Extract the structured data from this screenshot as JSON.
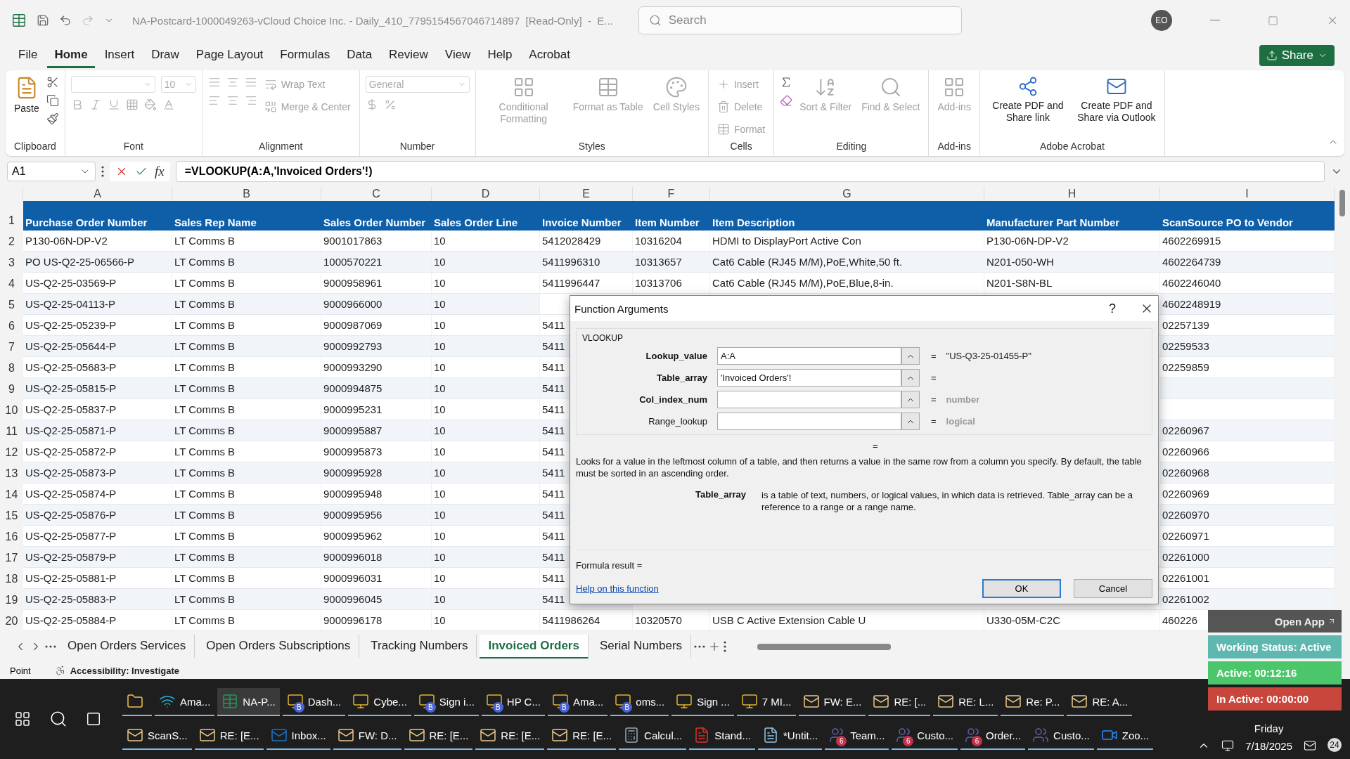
{
  "window": {
    "title": "NA-Postcard-1000049263-vCloud Choice Inc. - Daily_410_7795154567046714897  [Read-Only]  -  E...",
    "search_placeholder": "Search",
    "avatar": "EO"
  },
  "menu": [
    {
      "label": "File",
      "selected": false
    },
    {
      "label": "Home",
      "selected": true
    },
    {
      "label": "Insert",
      "selected": false
    },
    {
      "label": "Draw",
      "selected": false
    },
    {
      "label": "Page Layout",
      "selected": false
    },
    {
      "label": "Formulas",
      "selected": false
    },
    {
      "label": "Data",
      "selected": false
    },
    {
      "label": "Review",
      "selected": false
    },
    {
      "label": "View",
      "selected": false
    },
    {
      "label": "Help",
      "selected": false
    },
    {
      "label": "Acrobat",
      "selected": false
    }
  ],
  "share": "Share",
  "ribbon": [
    {
      "kind": "clipboard",
      "label": "Clipboard",
      "items": [
        {
          "label": "Paste",
          "disabled": false
        }
      ]
    },
    {
      "kind": "font",
      "label": "Font",
      "size": "10"
    },
    {
      "kind": "alignment",
      "label": "Alignment",
      "items": [
        {
          "label": "Wrap Text",
          "disabled": true
        },
        {
          "label": "Merge & Center",
          "disabled": true
        }
      ]
    },
    {
      "kind": "number",
      "label": "Number",
      "format": "General"
    },
    {
      "kind": "styles",
      "label": "Styles",
      "items": [
        {
          "label": "Conditional Formatting",
          "disabled": true
        },
        {
          "label": "Format as Table",
          "disabled": true
        },
        {
          "label": "Cell Styles",
          "disabled": true
        }
      ]
    },
    {
      "kind": "cells",
      "label": "Cells",
      "items": [
        {
          "label": "Insert",
          "disabled": true
        },
        {
          "label": "Delete",
          "disabled": true
        },
        {
          "label": "Format",
          "disabled": true
        }
      ]
    },
    {
      "kind": "editing",
      "label": "Editing",
      "items": [
        {
          "label": "Sort & Filter",
          "disabled": true
        },
        {
          "label": "Find & Select",
          "disabled": true
        }
      ]
    },
    {
      "kind": "addins",
      "label": "Add-ins",
      "items": [
        {
          "label": "Add-ins",
          "disabled": true
        }
      ]
    },
    {
      "kind": "acrobat",
      "label": "Adobe Acrobat",
      "items": [
        {
          "label": "Create PDF and Share link",
          "disabled": false
        },
        {
          "label": "Create PDF and Share via Outlook",
          "disabled": false
        }
      ]
    }
  ],
  "formula_bar": {
    "name_box": "A1",
    "fx": "fx",
    "formula": "=VLOOKUP(A:A,'Invoiced Orders'!)"
  },
  "sheet": {
    "columns": [
      "A",
      "B",
      "C",
      "D",
      "E",
      "F",
      "G",
      "H",
      "I"
    ],
    "header_row": {
      "num": "1",
      "cells": [
        "Purchase Order Number",
        "Sales Rep Name",
        "Sales Order Number",
        "Sales Order Line",
        "Invoice Number",
        "Item Number",
        "Item Description",
        "Manufacturer Part Number",
        "ScanSource PO to Vendor"
      ]
    },
    "rows": [
      {
        "num": "2",
        "cells": [
          "P130-06N-DP-V2",
          "LT Comms B",
          "9001017863",
          "10",
          "5412028429",
          "10316204",
          "HDMI to DisplayPort Active Con",
          "P130-06N-DP-V2",
          "4602269915"
        ]
      },
      {
        "num": "3",
        "cells": [
          "PO US-Q2-25-06566-P",
          "LT Comms B",
          "1000570221",
          "10",
          "5411996310",
          "10313657",
          "Cat6 Cable (RJ45 M/M),PoE,White,50 ft.",
          "N201-050-WH",
          "4602264739"
        ]
      },
      {
        "num": "4",
        "cells": [
          "US-Q2-25-03569-P",
          "LT Comms B",
          "9000958961",
          "10",
          "5411996447",
          "10313706",
          "Cat6 Cable (RJ45 M/M),PoE,Blue,8-in.",
          "N201-S8N-BL",
          "4602246040"
        ]
      },
      {
        "num": "5",
        "cells": [
          "US-Q2-25-04113-P",
          "LT Comms B",
          "9000966000",
          "10",
          null,
          null,
          null,
          null,
          "4602248919"
        ]
      },
      {
        "num": "6",
        "cells": [
          "US-Q2-25-05239-P",
          "LT Comms B",
          "9000987069",
          "10",
          "5411",
          null,
          null,
          null,
          "02257139"
        ]
      },
      {
        "num": "7",
        "cells": [
          "US-Q2-25-05644-P",
          "LT Comms B",
          "9000992793",
          "10",
          "5411",
          null,
          null,
          null,
          "02259533"
        ]
      },
      {
        "num": "8",
        "cells": [
          "US-Q2-25-05683-P",
          "LT Comms B",
          "9000993290",
          "10",
          "5411",
          null,
          null,
          null,
          "02259859"
        ]
      },
      {
        "num": "9",
        "cells": [
          "US-Q2-25-05815-P",
          "LT Comms B",
          "9000994875",
          "10",
          "5411",
          null,
          null,
          null,
          null
        ]
      },
      {
        "num": "10",
        "cells": [
          "US-Q2-25-05837-P",
          "LT Comms B",
          "9000995231",
          "10",
          "5411",
          null,
          null,
          null,
          null
        ]
      },
      {
        "num": "11",
        "cells": [
          "US-Q2-25-05871-P",
          "LT Comms B",
          "9000995887",
          "10",
          "5411",
          null,
          null,
          null,
          "02260967"
        ]
      },
      {
        "num": "12",
        "cells": [
          "US-Q2-25-05872-P",
          "LT Comms B",
          "9000995873",
          "10",
          "5411",
          null,
          null,
          null,
          "02260966"
        ]
      },
      {
        "num": "13",
        "cells": [
          "US-Q2-25-05873-P",
          "LT Comms B",
          "9000995928",
          "10",
          "5411",
          null,
          null,
          null,
          "02260968"
        ]
      },
      {
        "num": "14",
        "cells": [
          "US-Q2-25-05874-P",
          "LT Comms B",
          "9000995948",
          "10",
          "5411",
          null,
          null,
          null,
          "02260969"
        ]
      },
      {
        "num": "15",
        "cells": [
          "US-Q2-25-05876-P",
          "LT Comms B",
          "9000995956",
          "10",
          "5411",
          null,
          null,
          null,
          "02260970"
        ]
      },
      {
        "num": "16",
        "cells": [
          "US-Q2-25-05877-P",
          "LT Comms B",
          "9000995962",
          "10",
          "5411",
          null,
          null,
          null,
          "02260971"
        ]
      },
      {
        "num": "17",
        "cells": [
          "US-Q2-25-05879-P",
          "LT Comms B",
          "9000996018",
          "10",
          "5411",
          null,
          null,
          null,
          "02261000"
        ]
      },
      {
        "num": "18",
        "cells": [
          "US-Q2-25-05881-P",
          "LT Comms B",
          "9000996031",
          "10",
          "5411",
          null,
          null,
          null,
          "02261001"
        ]
      },
      {
        "num": "19",
        "cells": [
          "US-Q2-25-05883-P",
          "LT Comms B",
          "9000996045",
          "10",
          "5411",
          null,
          null,
          null,
          "02261002"
        ]
      },
      {
        "num": "20",
        "cells": [
          "US-Q2-25-05884-P",
          "LT Comms B",
          "9000996178",
          "10",
          "5411986264",
          "10320570",
          "USB C Active Extension Cable U",
          "U330-05M-C2C",
          "460226"
        ]
      }
    ]
  },
  "dialog": {
    "title": "Function Arguments",
    "help": "?",
    "function": "VLOOKUP",
    "args": [
      {
        "name": "Lookup_value",
        "required": true,
        "value": "A:A",
        "equals": "=",
        "result": {
          "text": "\"US-Q3-25-01455-P\"",
          "kind": "value"
        }
      },
      {
        "name": "Table_array",
        "required": true,
        "value": "'Invoiced Orders'!",
        "equals": "="
      },
      {
        "name": "Col_index_num",
        "required": true,
        "equals": "=",
        "result": {
          "text": "number",
          "kind": "hint"
        }
      },
      {
        "name": "Range_lookup",
        "required": false,
        "equals": "=",
        "result": {
          "text": "logical",
          "kind": "hint"
        }
      }
    ],
    "total_equals": "=",
    "description": "Looks for a value in the leftmost column of a table, and then returns a value in the same row from a column you specify. By default, the table must be sorted in an ascending order.",
    "arg_name": "Table_array",
    "arg_description": "is a table of text, numbers, or logical values, in which data is retrieved. Table_array can be a reference to a range or a range name.",
    "formula_result": "Formula result =",
    "help_link": "Help on this function",
    "ok": "OK",
    "cancel": "Cancel"
  },
  "sheet_tabs": [
    {
      "label": "Open Orders Services",
      "selected": false
    },
    {
      "label": "Open Orders Subscriptions",
      "selected": false
    },
    {
      "label": "Tracking Numbers",
      "selected": false
    },
    {
      "label": "Invoiced Orders",
      "selected": true
    },
    {
      "label": "Serial Numbers",
      "selected": false
    }
  ],
  "status_bar": {
    "mode": "Point",
    "accessibility": "Accessibility: Investigate"
  },
  "taskbar": {
    "top_row": [
      {
        "kind": "explorer",
        "selected": false
      },
      {
        "kind": "edge",
        "label": "Ama...",
        "selected": false
      },
      {
        "kind": "excel",
        "label": "NA-P...",
        "selected": true
      },
      {
        "kind": "chrome",
        "label": "Dash...",
        "badge": "B",
        "selected": false
      },
      {
        "kind": "chrome",
        "label": "Cybe...",
        "selected": false
      },
      {
        "kind": "chrome",
        "label": "Sign i...",
        "badge": "B",
        "selected": false
      },
      {
        "kind": "chrome",
        "label": "HP C...",
        "badge": "B",
        "selected": false
      },
      {
        "kind": "chrome",
        "label": "Ama...",
        "badge": "B",
        "selected": false
      },
      {
        "kind": "chrome",
        "label": "oms...",
        "badge": "B",
        "selected": false
      },
      {
        "kind": "chrome",
        "label": "Sign ...",
        "selected": false
      },
      {
        "kind": "chrome",
        "label": "7 MI...",
        "selected": false
      },
      {
        "kind": "mail",
        "label": "FW: E...",
        "selected": false
      },
      {
        "kind": "mail",
        "label": "RE: [...",
        "selected": false
      },
      {
        "kind": "mail",
        "label": "RE: L...",
        "selected": false
      },
      {
        "kind": "mail",
        "label": "Re: P...",
        "selected": false
      },
      {
        "kind": "mail",
        "label": "RE: A...",
        "selected": false
      }
    ],
    "bottom_row": [
      {
        "kind": "mail",
        "label": "ScanS...",
        "selected": false
      },
      {
        "kind": "mail",
        "label": "RE: [E...",
        "selected": false
      },
      {
        "kind": "outlook",
        "label": "Inbox...",
        "selected": false
      },
      {
        "kind": "mail",
        "label": "FW: D...",
        "selected": false
      },
      {
        "kind": "mail",
        "label": "RE: [E...",
        "selected": false
      },
      {
        "kind": "mail",
        "label": "RE: [E...",
        "selected": false
      },
      {
        "kind": "mail",
        "label": "RE: [E...",
        "selected": false
      },
      {
        "kind": "calculator",
        "label": "Calcul...",
        "selected": false
      },
      {
        "kind": "pdf",
        "label": "Stand...",
        "selected": false
      },
      {
        "kind": "notepad",
        "label": "*Untit...",
        "selected": false
      },
      {
        "kind": "teams",
        "label": "Team...",
        "badge": "6",
        "selected": false
      },
      {
        "kind": "teams",
        "label": "Custo...",
        "badge": "6",
        "selected": false
      },
      {
        "kind": "teams",
        "label": "Order...",
        "badge": "6",
        "selected": false
      },
      {
        "kind": "teams",
        "label": "Custo...",
        "selected": false
      },
      {
        "kind": "zoom",
        "label": "Zoo...",
        "selected": false
      }
    ],
    "day": "Friday",
    "date": "7/18/2025",
    "notifications": "24"
  },
  "tracker": {
    "open_app": "Open App",
    "status": "Working Status: Active",
    "active": "Active: 00:12:16",
    "inactive": "In Active: 00:00:00"
  }
}
